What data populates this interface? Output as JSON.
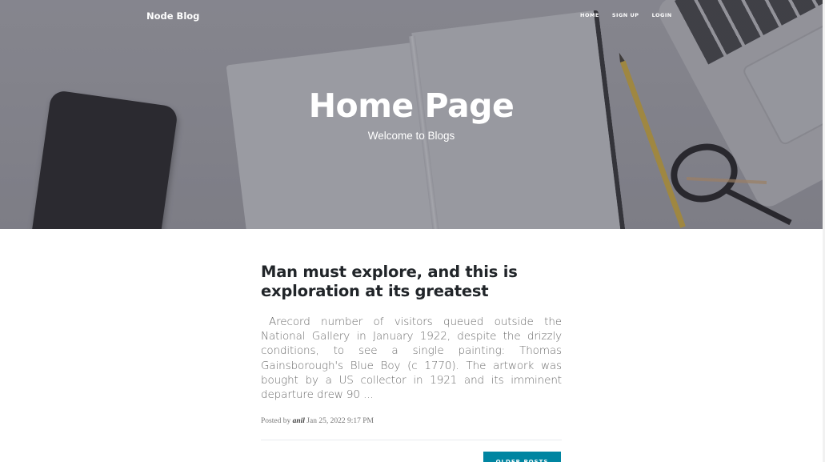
{
  "nav": {
    "brand": "Node Blog",
    "links": [
      "HOME",
      "SIGN UP",
      "LOGIN"
    ]
  },
  "hero": {
    "title": "Home Page",
    "subtitle": "Welcome to Blogs"
  },
  "posts": [
    {
      "title": "Man must explore, and this is exploration at its greatest",
      "excerpt": "Arecord number of visitors queued outside the National Gallery in January 1922, despite the drizzly conditions, to see a single painting: Thomas Gainsborough's Blue Boy (c 1770). The artwork was bought by a US collector in 1921 and its imminent departure drew 90 ...",
      "meta_prefix": "Posted by",
      "author": "anil",
      "date": "Jan 25, 2022 9:17 PM"
    }
  ],
  "pager": {
    "older_label": "OLDER POSTS"
  },
  "colors": {
    "accent": "#0085a1",
    "hero_overlay": "#4a4c55",
    "text": "#212529",
    "muted": "#6c6c6c"
  }
}
